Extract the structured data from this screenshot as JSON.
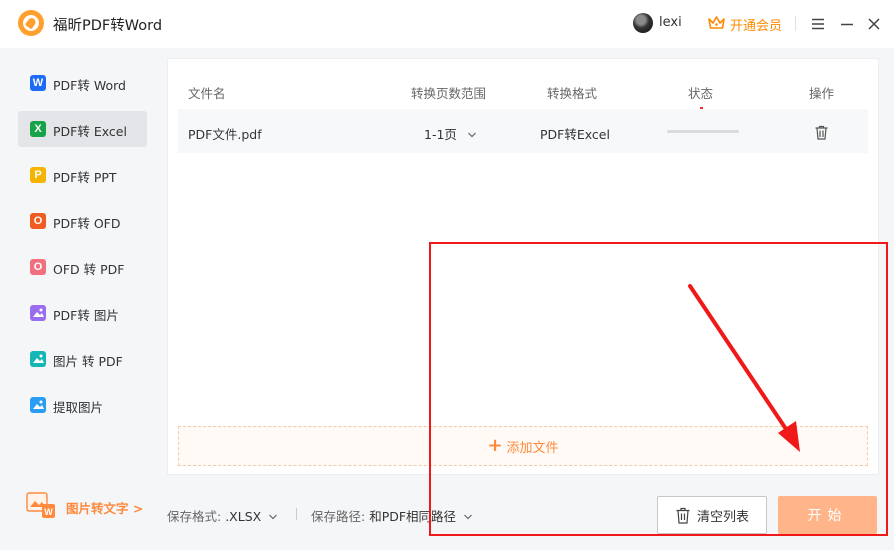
{
  "app": {
    "title": "福昕PDF转Word"
  },
  "user": {
    "name": "lexi"
  },
  "vip": {
    "label": "开通会员",
    "icon": "crown-icon"
  },
  "window_controls": [
    "menu-icon",
    "minimize-icon",
    "close-icon"
  ],
  "colors": {
    "accent": "#ff8a3d",
    "accent_light": "#ffb48a",
    "annotation": "#f01818"
  },
  "sidebar": {
    "items": [
      {
        "label": "PDF转 Word",
        "icon_text": "W",
        "icon_color": "#1e6cf5",
        "active": false
      },
      {
        "label": "PDF转 Excel",
        "icon_text": "X",
        "icon_color": "#16a34a",
        "active": true
      },
      {
        "label": "PDF转 PPT",
        "icon_text": "P",
        "icon_color": "#f5b400",
        "active": false
      },
      {
        "label": "PDF转 OFD",
        "icon_text": "O",
        "icon_color": "#f05a23",
        "active": false
      },
      {
        "label": "OFD 转 PDF",
        "icon_text": "O",
        "icon_color": "#f07080",
        "active": false
      },
      {
        "label": "PDF转 图片",
        "icon_text": "",
        "icon_color": "#9b6cf0",
        "active": false
      },
      {
        "label": "图片 转 PDF",
        "icon_text": "",
        "icon_color": "#17b6b6",
        "active": false
      },
      {
        "label": "提取图片",
        "icon_text": "",
        "icon_color": "#2a9df4",
        "active": false
      }
    ],
    "promo": {
      "label": "图片转文字 >",
      "badge": "W"
    }
  },
  "table": {
    "headers": {
      "name": "文件名",
      "range": "转换页数范围",
      "format": "转换格式",
      "status": "状态",
      "action": "操作"
    },
    "rows": [
      {
        "name": "PDF文件.pdf",
        "range": "1-1页",
        "format": "PDF转Excel",
        "progress": 0
      }
    ]
  },
  "add_files": {
    "label": "添加文件"
  },
  "bottom": {
    "format_label": "保存格式:",
    "format_value": ".XLSX",
    "path_label": "保存路径:",
    "path_value": "和PDF相同路径",
    "clear_label": "清空列表",
    "start_label": "开始"
  }
}
